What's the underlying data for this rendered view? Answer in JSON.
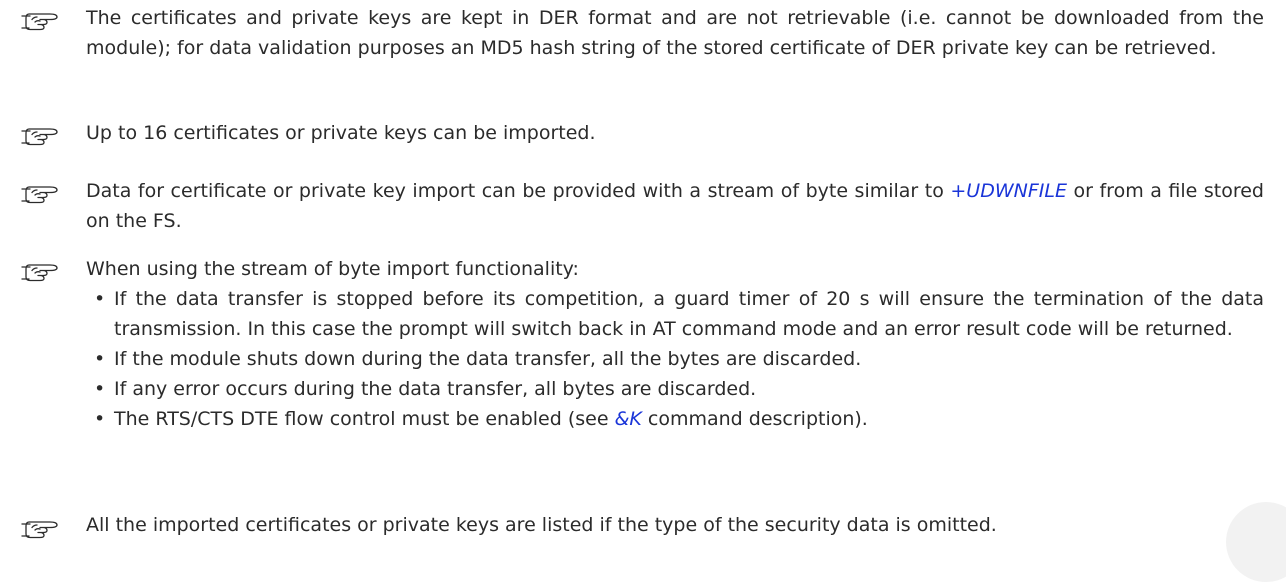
{
  "icons": {
    "note": "pointing-hand-icon"
  },
  "colors": {
    "text": "#2b2b2b",
    "link": "#1a35d8"
  },
  "notes": {
    "note1": {
      "text": "The certificates and private keys are kept in DER format and are not retrievable (i.e. cannot be downloaded from the module); for data validation purposes an MD5 hash string of the stored certificate of DER private key can be retrieved."
    },
    "note2": {
      "text": "Up to 16 certificates or private keys can be imported."
    },
    "note3": {
      "text_before": "Data for certificate or private key import can be provided with a stream of byte similar to ",
      "link": "+UDWNFILE",
      "text_after": " or from a file stored on the FS."
    },
    "note4": {
      "intro": "When using the stream of byte import functionality:",
      "bullets": {
        "b1": "If the data transfer is stopped before its competition, a guard timer of 20 s will ensure the termination of the data transmission. In this case the prompt will switch back in AT command mode and an error result code will be returned.",
        "b2": "If the module shuts down during the data transfer, all the bytes are discarded.",
        "b3": "If any error occurs during the data transfer, all bytes are discarded.",
        "b4_before": "The RTS/CTS DTE flow control must be enabled (see ",
        "b4_link": "&K",
        "b4_after": " command description)."
      }
    },
    "note5": {
      "text": "All the imported certificates or private keys are listed if the type of the security data is omitted."
    }
  }
}
